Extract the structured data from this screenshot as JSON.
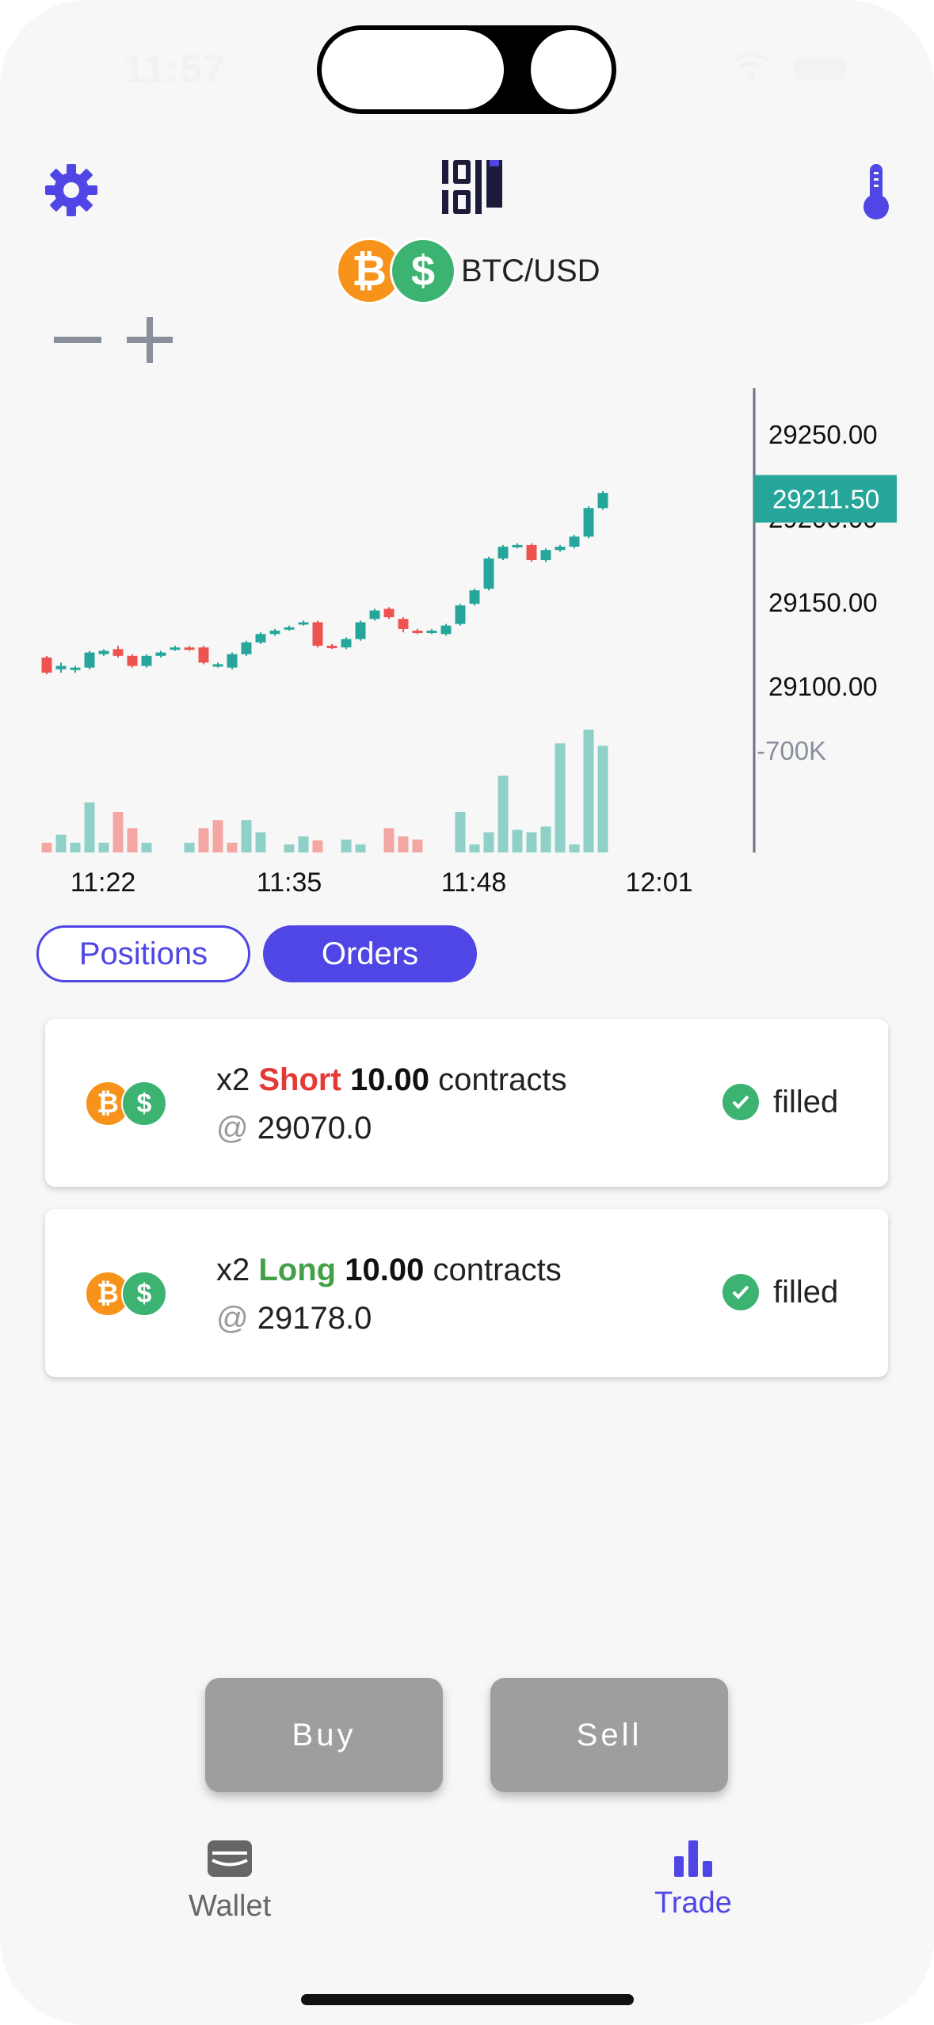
{
  "status_bar": {
    "time": "11:57"
  },
  "header": {
    "pair_label": "BTC/USD"
  },
  "zoom": {
    "minus": "−",
    "plus": "+"
  },
  "chart_data": {
    "type": "candlestick",
    "x_ticks": [
      "11:22",
      "11:35",
      "11:48",
      "12:01"
    ],
    "y_ticks": [
      "29250.00",
      "29200.00",
      "29150.00",
      "29100.00"
    ],
    "current_price": "29211.50",
    "volume_tick": "-700K",
    "ylim": [
      29070,
      29262
    ],
    "candles": [
      {
        "o": 29117,
        "c": 29108,
        "h": 29118,
        "l": 29107
      },
      {
        "o": 29110,
        "c": 29112,
        "h": 29114,
        "l": 29108
      },
      {
        "o": 29110,
        "c": 29111,
        "h": 29112,
        "l": 29108
      },
      {
        "o": 29111,
        "c": 29120,
        "h": 29121,
        "l": 29110
      },
      {
        "o": 29119,
        "c": 29121,
        "h": 29122,
        "l": 29118
      },
      {
        "o": 29122,
        "c": 29118,
        "h": 29124,
        "l": 29117
      },
      {
        "o": 29118,
        "c": 29112,
        "h": 29119,
        "l": 29111
      },
      {
        "o": 29112,
        "c": 29118,
        "h": 29119,
        "l": 29111
      },
      {
        "o": 29118,
        "c": 29120,
        "h": 29121,
        "l": 29117
      },
      {
        "o": 29122,
        "c": 29123,
        "h": 29124,
        "l": 29121
      },
      {
        "o": 29123,
        "c": 29122,
        "h": 29124,
        "l": 29121
      },
      {
        "o": 29123,
        "c": 29114,
        "h": 29124,
        "l": 29113
      },
      {
        "o": 29112,
        "c": 29113,
        "h": 29114,
        "l": 29111
      },
      {
        "o": 29111,
        "c": 29119,
        "h": 29120,
        "l": 29110
      },
      {
        "o": 29119,
        "c": 29126,
        "h": 29127,
        "l": 29118
      },
      {
        "o": 29126,
        "c": 29131,
        "h": 29132,
        "l": 29125
      },
      {
        "o": 29131,
        "c": 29133,
        "h": 29134,
        "l": 29130
      },
      {
        "o": 29134,
        "c": 29135,
        "h": 29136,
        "l": 29133
      },
      {
        "o": 29137,
        "c": 29138,
        "h": 29139,
        "l": 29136
      },
      {
        "o": 29138,
        "c": 29124,
        "h": 29139,
        "l": 29123
      },
      {
        "o": 29124,
        "c": 29123,
        "h": 29125,
        "l": 29122
      },
      {
        "o": 29123,
        "c": 29128,
        "h": 29129,
        "l": 29122
      },
      {
        "o": 29128,
        "c": 29138,
        "h": 29139,
        "l": 29127
      },
      {
        "o": 29140,
        "c": 29145,
        "h": 29146,
        "l": 29139
      },
      {
        "o": 29146,
        "c": 29141,
        "h": 29147,
        "l": 29140
      },
      {
        "o": 29140,
        "c": 29134,
        "h": 29141,
        "l": 29132
      },
      {
        "o": 29133,
        "c": 29132,
        "h": 29134,
        "l": 29131
      },
      {
        "o": 29132,
        "c": 29133,
        "h": 29134,
        "l": 29131
      },
      {
        "o": 29131,
        "c": 29136,
        "h": 29137,
        "l": 29130
      },
      {
        "o": 29137,
        "c": 29148,
        "h": 29149,
        "l": 29136
      },
      {
        "o": 29149,
        "c": 29157,
        "h": 29158,
        "l": 29148
      },
      {
        "o": 29158,
        "c": 29176,
        "h": 29177,
        "l": 29157
      },
      {
        "o": 29176,
        "c": 29183,
        "h": 29184,
        "l": 29175
      },
      {
        "o": 29183,
        "c": 29184,
        "h": 29185,
        "l": 29182
      },
      {
        "o": 29184,
        "c": 29175,
        "h": 29185,
        "l": 29174
      },
      {
        "o": 29175,
        "c": 29181,
        "h": 29182,
        "l": 29174
      },
      {
        "o": 29181,
        "c": 29183,
        "h": 29184,
        "l": 29180
      },
      {
        "o": 29183,
        "c": 29189,
        "h": 29190,
        "l": 29182
      },
      {
        "o": 29189,
        "c": 29206,
        "h": 29207,
        "l": 29188
      },
      {
        "o": 29206,
        "c": 29215,
        "h": 29216,
        "l": 29205
      }
    ],
    "volume_scale": 0.85,
    "volumes": [
      {
        "v": 0.12,
        "up": false
      },
      {
        "v": 0.22,
        "up": true
      },
      {
        "v": 0.12,
        "up": true
      },
      {
        "v": 0.62,
        "up": true
      },
      {
        "v": 0.12,
        "up": true
      },
      {
        "v": 0.5,
        "up": false
      },
      {
        "v": 0.3,
        "up": false
      },
      {
        "v": 0.12,
        "up": true
      },
      {
        "v": 0.0,
        "up": true
      },
      {
        "v": 0.0,
        "up": true
      },
      {
        "v": 0.12,
        "up": true
      },
      {
        "v": 0.3,
        "up": false
      },
      {
        "v": 0.4,
        "up": false
      },
      {
        "v": 0.12,
        "up": false
      },
      {
        "v": 0.4,
        "up": true
      },
      {
        "v": 0.25,
        "up": true
      },
      {
        "v": 0.0,
        "up": true
      },
      {
        "v": 0.1,
        "up": true
      },
      {
        "v": 0.2,
        "up": true
      },
      {
        "v": 0.15,
        "up": false
      },
      {
        "v": 0.0,
        "up": true
      },
      {
        "v": 0.16,
        "up": true
      },
      {
        "v": 0.1,
        "up": true
      },
      {
        "v": 0.0,
        "up": true
      },
      {
        "v": 0.3,
        "up": false
      },
      {
        "v": 0.2,
        "up": false
      },
      {
        "v": 0.16,
        "up": false
      },
      {
        "v": 0.0,
        "up": true
      },
      {
        "v": 0.0,
        "up": true
      },
      {
        "v": 0.5,
        "up": true
      },
      {
        "v": 0.1,
        "up": true
      },
      {
        "v": 0.25,
        "up": true
      },
      {
        "v": 0.95,
        "up": true
      },
      {
        "v": 0.28,
        "up": true
      },
      {
        "v": 0.25,
        "up": true
      },
      {
        "v": 0.32,
        "up": true
      },
      {
        "v": 1.35,
        "up": true
      },
      {
        "v": 0.1,
        "up": true
      },
      {
        "v": 1.52,
        "up": true
      },
      {
        "v": 1.32,
        "up": true
      }
    ],
    "colors": {
      "up": "#26a69a",
      "down": "#ef5350",
      "up_vol": "#8fd0c8",
      "down_vol": "#f4a6a4"
    }
  },
  "tabs": {
    "positions": "Positions",
    "orders": "Orders"
  },
  "orders": [
    {
      "leverage": "x2",
      "side": "Short",
      "quantity": "10.00",
      "unit": "contracts",
      "at": "@",
      "price": "29070.0",
      "status": "filled"
    },
    {
      "leverage": "x2",
      "side": "Long",
      "quantity": "10.00",
      "unit": "contracts",
      "at": "@",
      "price": "29178.0",
      "status": "filled"
    }
  ],
  "actions": {
    "buy": "Buy",
    "sell": "Sell"
  },
  "nav": {
    "wallet": "Wallet",
    "trade": "Trade"
  },
  "coin_glyphs": {
    "btc": "₿",
    "usd": "$"
  },
  "colors": {
    "accent": "#4f46e5",
    "short": "#e53935",
    "long": "#43a047",
    "button_gray": "#9e9e9e"
  }
}
